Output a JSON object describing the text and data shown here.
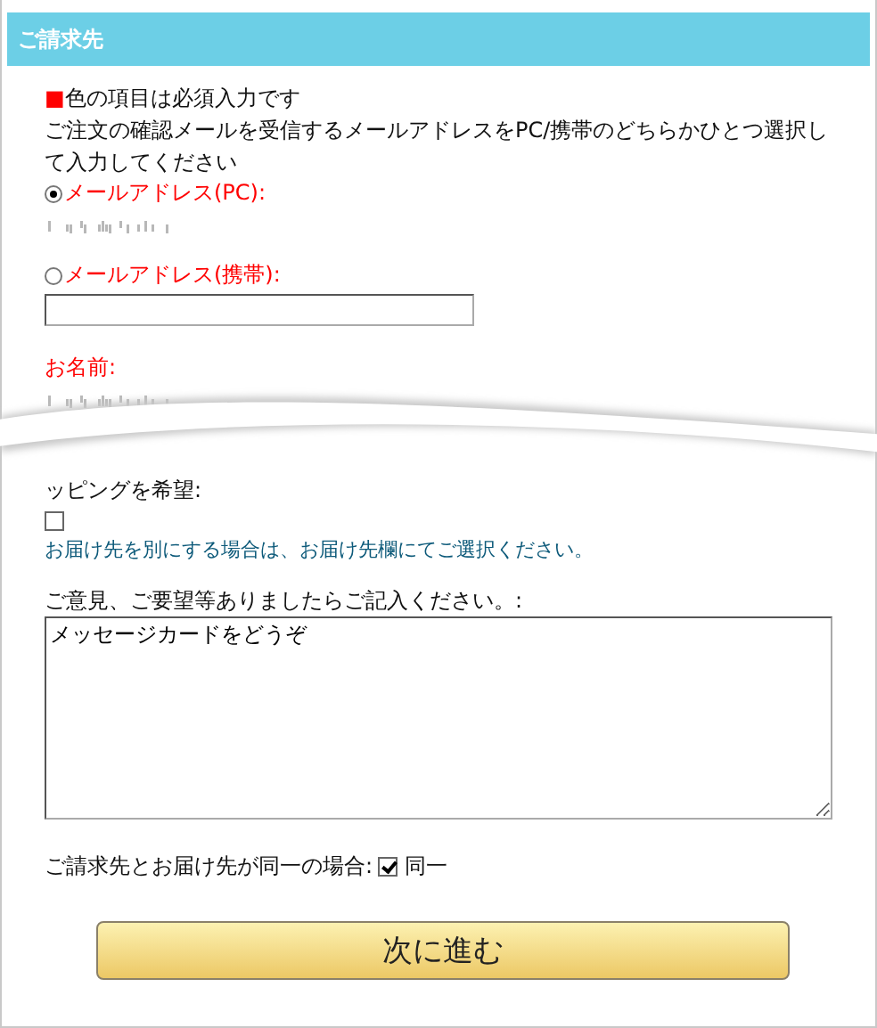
{
  "section": {
    "title": "ご請求先"
  },
  "required_note": {
    "marker": "■",
    "color": "#ff0000",
    "text": "色の項目は必須入力です"
  },
  "instructions": "ご注文の確認メールを受信するメールアドレスをPC/携帯のどちらかひとつ選択して入力してください",
  "email_options": [
    {
      "label": "メールアドレス(PC):",
      "selected": true,
      "kind": "masked"
    },
    {
      "label": "メールアドレス(携帯):",
      "selected": false,
      "kind": "input"
    }
  ],
  "name_field": {
    "label": "お名前:",
    "kind": "masked"
  },
  "wrapping": {
    "label": "ッピングを希望:",
    "checked": false
  },
  "delivery_note": "お届け先を別にする場合は、お届け先欄にてご選択ください。",
  "comments": {
    "label": "ご意見、ご要望等ありましたらご記入ください。:",
    "value": "メッセージカードをどうぞ"
  },
  "same_address": {
    "label": "ご請求先とお届け先が同一の場合:",
    "option": "同一",
    "checked": true
  },
  "buttons": [
    "次に進む"
  ]
}
